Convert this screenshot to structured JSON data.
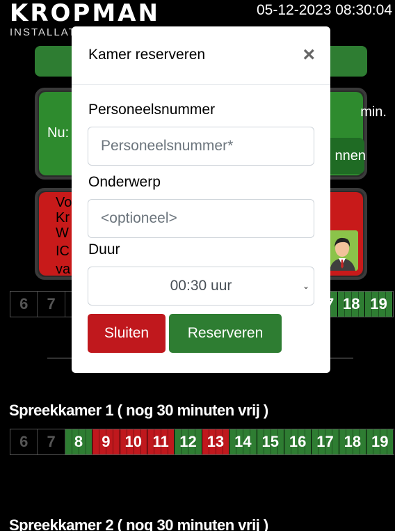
{
  "header": {
    "logo_text": "KROPMAN",
    "logo_sub": "INSTALLAT",
    "datetime": "05-12-2023 08:30:04"
  },
  "current": {
    "now_label": "Nu:",
    "minutes_label": "min.",
    "start_label": "nnen"
  },
  "next": {
    "lines": [
      "Vo",
      "Kr",
      "W",
      "IC",
      "va"
    ]
  },
  "timeline_top": {
    "visible_left": [
      "6",
      "7"
    ],
    "visible_right": [
      "7",
      "18",
      "19"
    ]
  },
  "rooms": [
    {
      "title": "Spreekkamer 1 ( nog 30 minuten vrij )",
      "slots": [
        {
          "hour": "6",
          "state": "past"
        },
        {
          "hour": "7",
          "state": "past"
        },
        {
          "hour": "8",
          "state": "free"
        },
        {
          "hour": "9",
          "state": "busy"
        },
        {
          "hour": "10",
          "state": "busy"
        },
        {
          "hour": "11",
          "state": "busy"
        },
        {
          "hour": "12",
          "state": "free"
        },
        {
          "hour": "13",
          "state": "busy"
        },
        {
          "hour": "14",
          "state": "free"
        },
        {
          "hour": "15",
          "state": "free"
        },
        {
          "hour": "16",
          "state": "free"
        },
        {
          "hour": "17",
          "state": "free"
        },
        {
          "hour": "18",
          "state": "free"
        },
        {
          "hour": "19",
          "state": "free"
        }
      ]
    },
    {
      "title": "Spreekkamer 2 ( nog 30 minuten vrij )"
    }
  ],
  "modal": {
    "title": "Kamer reserveren",
    "close_symbol": "×",
    "employee_label": "Personeelsnummer",
    "employee_placeholder": "Personeelsnummer*",
    "subject_label": "Onderwerp",
    "subject_placeholder": "<optioneel>",
    "duration_label": "Duur",
    "duration_value": "00:30 uur",
    "caret": "⌄",
    "close_button": "Sluiten",
    "reserve_button": "Reserveren"
  },
  "colors": {
    "free": "#2e7d32",
    "busy": "#c0181d",
    "background": "#000000"
  }
}
